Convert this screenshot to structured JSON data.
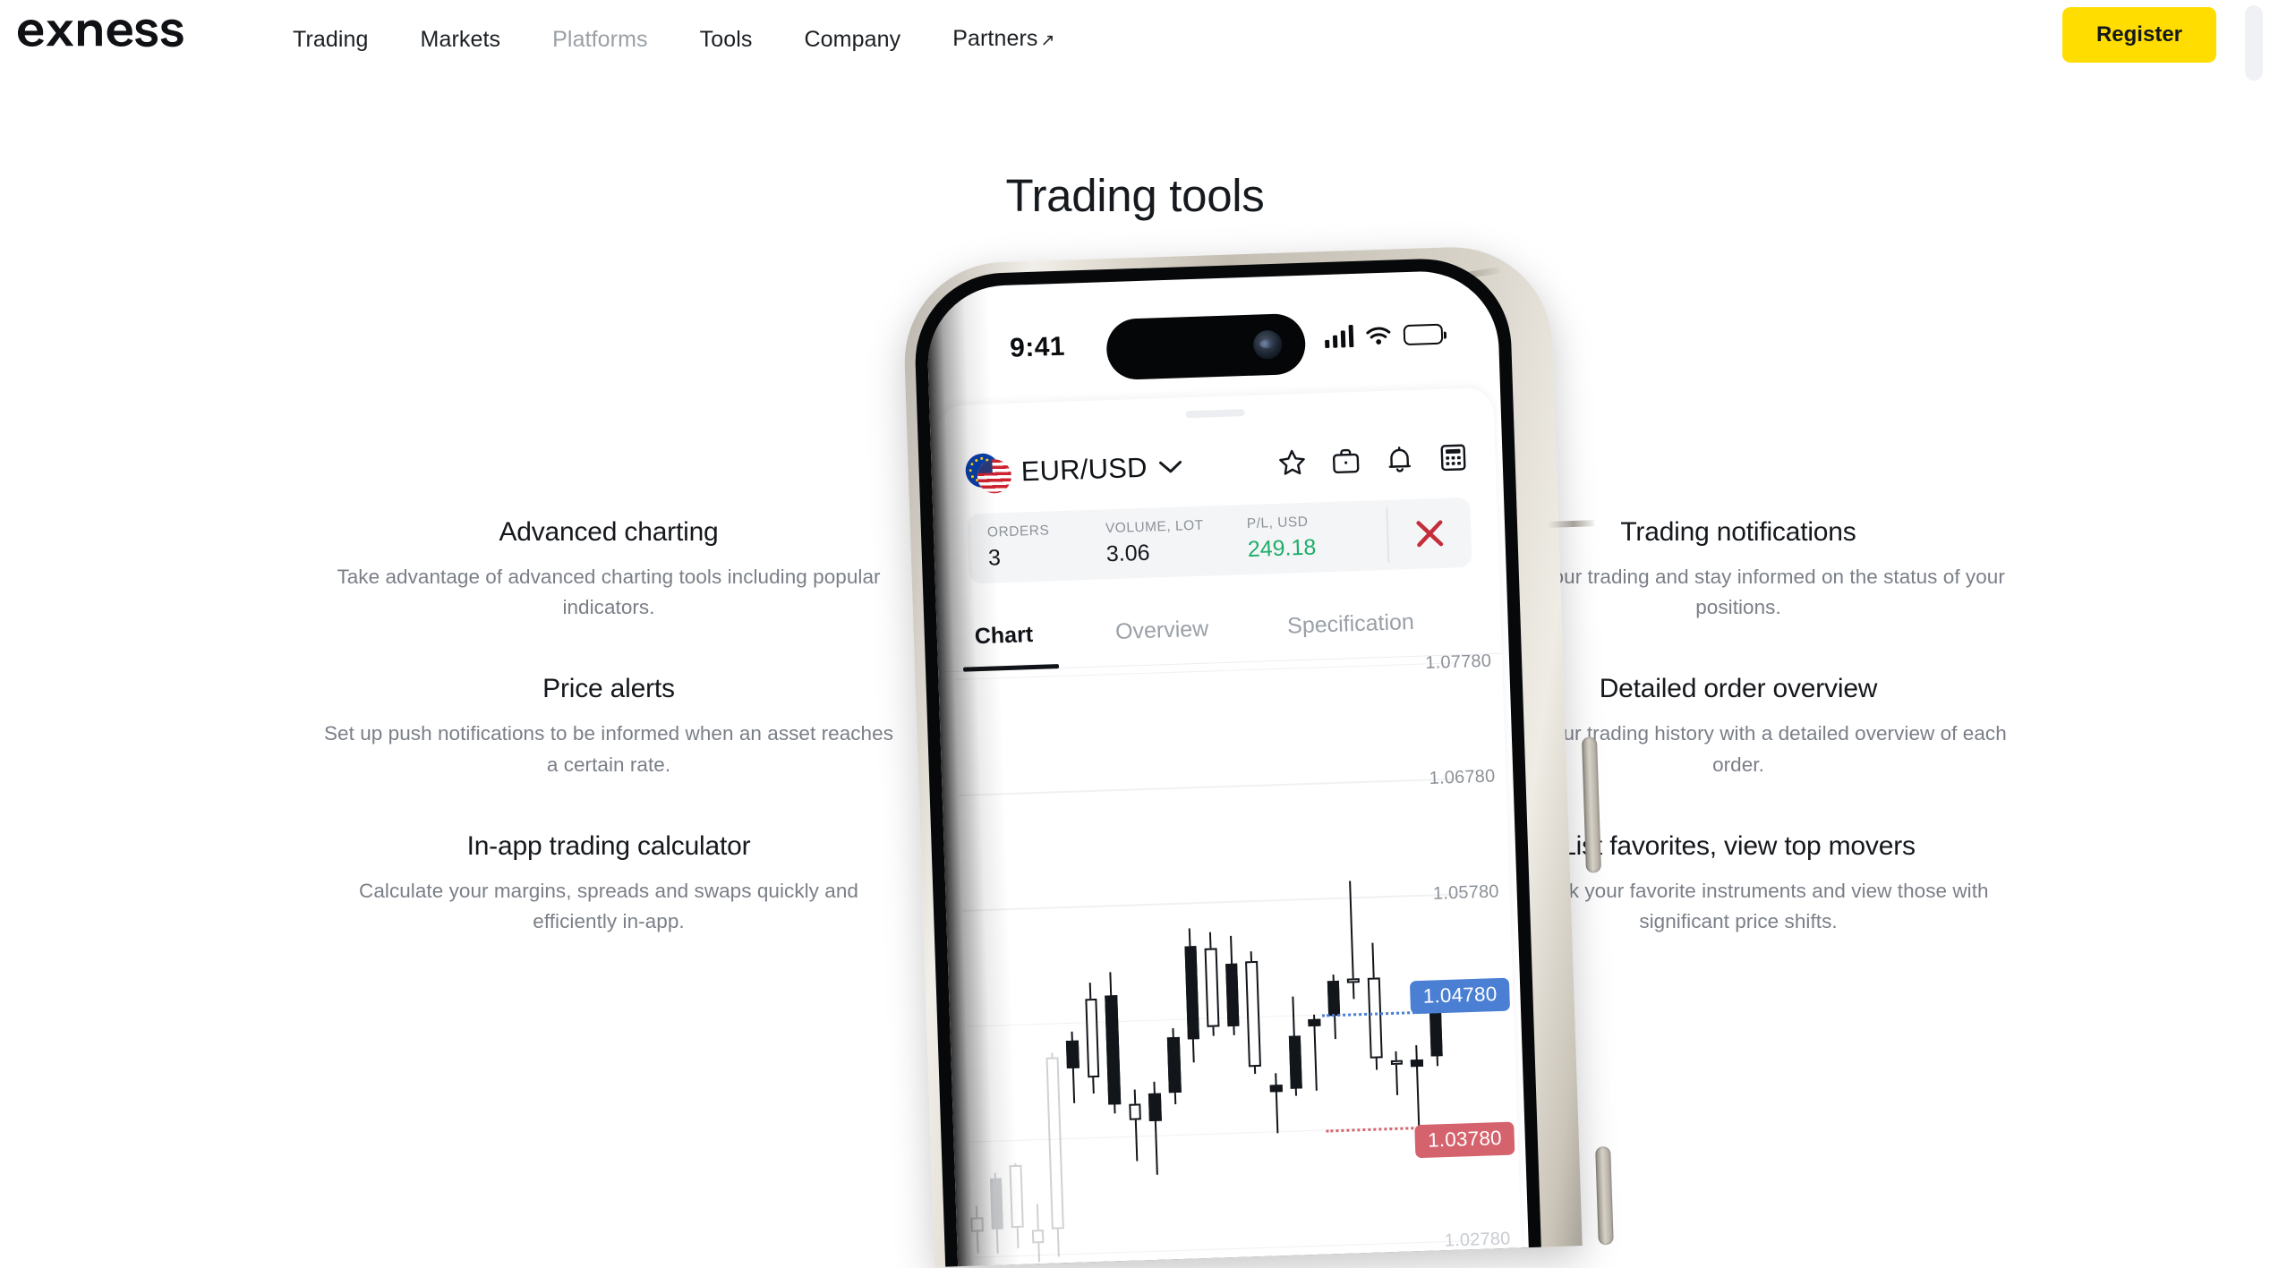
{
  "brand": {
    "logo_text": "exness",
    "accent_yellow": "#ffdd00"
  },
  "nav": {
    "links": [
      {
        "label": "Trading",
        "muted": false,
        "external": false
      },
      {
        "label": "Markets",
        "muted": false,
        "external": false
      },
      {
        "label": "Platforms",
        "muted": true,
        "external": false
      },
      {
        "label": "Tools",
        "muted": false,
        "external": false
      },
      {
        "label": "Company",
        "muted": false,
        "external": false
      },
      {
        "label": "Partners",
        "muted": false,
        "external": true,
        "external_glyph": "↗"
      }
    ],
    "register_label": "Register"
  },
  "page": {
    "title": "Trading tools"
  },
  "features_left": [
    {
      "title": "Advanced charting",
      "desc": "Take advantage of advanced charting tools including popular indicators."
    },
    {
      "title": "Price alerts",
      "desc": "Set up push notifications to be informed when an asset reaches a certain rate."
    },
    {
      "title": "In-app trading calculator",
      "desc": "Calculate your margins, spreads and swaps quickly and efficiently in-app."
    }
  ],
  "features_right": [
    {
      "title": "Trading notifications",
      "desc": "Control your trading and stay informed on the status of your positions."
    },
    {
      "title": "Detailed order overview",
      "desc": "Review your trading history with a detailed overview of each order."
    },
    {
      "title": "List favorites, view top movers",
      "desc": "Bookmark your favorite instruments and view those with significant price shifts."
    }
  ],
  "phone": {
    "status_bar": {
      "time": "9:41",
      "icons": [
        "cellular-signal-icon",
        "wifi-icon",
        "battery-icon"
      ]
    },
    "app": {
      "instrument": "EUR/USD",
      "instrument_flags": [
        "eu-flag",
        "us-flag"
      ],
      "dropdown_glyph": "chevron-down-icon",
      "header_icons": [
        "star-icon",
        "briefcase-icon",
        "bell-icon",
        "calculator-icon"
      ],
      "order_strip": {
        "cells": [
          {
            "label": "ORDERS",
            "value": "3",
            "profit": false
          },
          {
            "label": "VOLUME, LOT",
            "value": "3.06",
            "profit": false
          },
          {
            "label": "P/L, USD",
            "value": "249.18",
            "profit": true
          }
        ],
        "close_icon": "close-x-icon",
        "close_color": "#c42e3b"
      },
      "tabs": [
        {
          "label": "Chart",
          "active": true
        },
        {
          "label": "Overview",
          "active": false
        },
        {
          "label": "Specification",
          "active": false
        }
      ]
    }
  },
  "chart_data": {
    "type": "candlestick",
    "title": "EUR/USD",
    "xlabel": "",
    "ylabel": "",
    "grid": true,
    "legend": "none",
    "y_ticks": [
      "1.07780",
      "1.06780",
      "1.05780",
      "1.04780",
      "1.03780",
      "1.02780"
    ],
    "ylim": [
      1.0278,
      1.0778
    ],
    "price_lines": [
      {
        "name": "bid",
        "value": "1.04780",
        "color": "#4a7fd4",
        "style": "dotted"
      },
      {
        "name": "ask",
        "value": "1.03780",
        "color": "#d4636d",
        "style": "dotted"
      }
    ],
    "colors": {
      "up": "#ffffff",
      "down": "#12161b",
      "outline": "#12161b"
    },
    "candles": [
      {
        "o": 1.03,
        "h": 1.0322,
        "l": 1.0281,
        "c": 1.0312,
        "dir": "up",
        "ghost": true
      },
      {
        "o": 1.0345,
        "h": 1.035,
        "l": 1.028,
        "c": 1.0301,
        "dir": "down",
        "ghost": true
      },
      {
        "o": 1.0302,
        "h": 1.0358,
        "l": 1.0284,
        "c": 1.0356,
        "dir": "up",
        "ghost": true
      },
      {
        "o": 1.03,
        "h": 1.0322,
        "l": 1.0272,
        "c": 1.0288,
        "dir": "up",
        "ghost": true
      },
      {
        "o": 1.03,
        "h": 1.0452,
        "l": 1.0276,
        "c": 1.0448,
        "dir": "up",
        "ghost": true
      },
      {
        "o": 1.0438,
        "h": 1.047,
        "l": 1.0408,
        "c": 1.0462,
        "dir": "down",
        "ghost": false
      },
      {
        "o": 1.043,
        "h": 1.0512,
        "l": 1.0416,
        "c": 1.0498,
        "dir": "up",
        "ghost": false
      },
      {
        "o": 1.05,
        "h": 1.052,
        "l": 1.0398,
        "c": 1.0406,
        "dir": "down",
        "ghost": false
      },
      {
        "o": 1.0392,
        "h": 1.0418,
        "l": 1.0356,
        "c": 1.0406,
        "dir": "up",
        "ghost": false
      },
      {
        "o": 1.039,
        "h": 1.0424,
        "l": 1.0344,
        "c": 1.0414,
        "dir": "down",
        "ghost": false
      },
      {
        "o": 1.0414,
        "h": 1.047,
        "l": 1.0404,
        "c": 1.0462,
        "dir": "down",
        "ghost": false
      },
      {
        "o": 1.046,
        "h": 1.0556,
        "l": 1.044,
        "c": 1.054,
        "dir": "down",
        "ghost": false
      },
      {
        "o": 1.0538,
        "h": 1.0552,
        "l": 1.0462,
        "c": 1.047,
        "dir": "up",
        "ghost": false
      },
      {
        "o": 1.047,
        "h": 1.0548,
        "l": 1.0462,
        "c": 1.0524,
        "dir": "down",
        "ghost": false
      },
      {
        "o": 1.0526,
        "h": 1.0534,
        "l": 1.0428,
        "c": 1.0434,
        "dir": "up",
        "ghost": false
      },
      {
        "o": 1.0412,
        "h": 1.0428,
        "l": 1.0376,
        "c": 1.0418,
        "dir": "down",
        "ghost": false
      },
      {
        "o": 1.0414,
        "h": 1.0494,
        "l": 1.0408,
        "c": 1.046,
        "dir": "down",
        "ghost": false
      },
      {
        "o": 1.0468,
        "h": 1.0478,
        "l": 1.0412,
        "c": 1.0474,
        "dir": "down",
        "ghost": false
      },
      {
        "o": 1.0476,
        "h": 1.0512,
        "l": 1.0456,
        "c": 1.0506,
        "dir": "down",
        "ghost": false
      },
      {
        "o": 1.0504,
        "h": 1.0592,
        "l": 1.049,
        "c": 1.0508,
        "dir": "up",
        "ghost": false
      },
      {
        "o": 1.0508,
        "h": 1.0538,
        "l": 1.0428,
        "c": 1.0438,
        "dir": "up",
        "ghost": false
      },
      {
        "o": 1.0436,
        "h": 1.0444,
        "l": 1.0406,
        "c": 1.0432,
        "dir": "up",
        "ghost": false
      },
      {
        "o": 1.043,
        "h": 1.0448,
        "l": 1.0372,
        "c": 1.0436,
        "dir": "down",
        "ghost": false
      },
      {
        "o": 1.0438,
        "h": 1.0486,
        "l": 1.043,
        "c": 1.048,
        "dir": "down",
        "ghost": false
      }
    ]
  }
}
